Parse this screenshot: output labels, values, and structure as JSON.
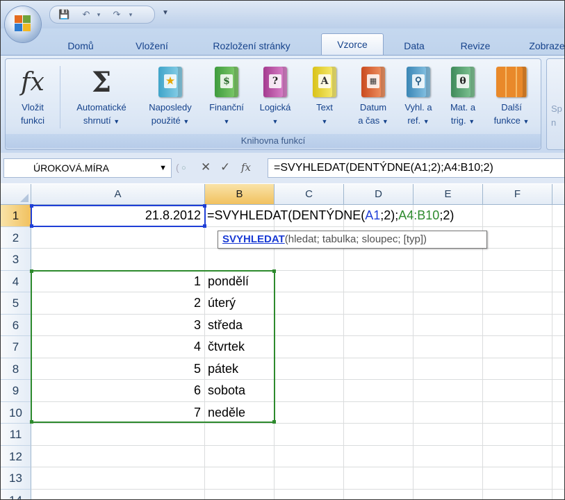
{
  "tabs": [
    "Domů",
    "Vložení",
    "Rozložení stránky",
    "Vzorce",
    "Data",
    "Revize",
    "Zobraze"
  ],
  "active_tab": "Vzorce",
  "ribbon": {
    "insert_function": {
      "line1": "Vložit",
      "line2": "funkci"
    },
    "autosum": {
      "line1": "Automatické",
      "line2": "shrnutí"
    },
    "recent": {
      "line1": "Naposledy",
      "line2": "použité"
    },
    "financial": {
      "line1": "Finanční"
    },
    "logical": {
      "line1": "Logická"
    },
    "text": {
      "line1": "Text"
    },
    "datetime": {
      "line1": "Datum",
      "line2": "a čas"
    },
    "lookup": {
      "line1": "Vyhl. a",
      "line2": "ref."
    },
    "math": {
      "line1": "Mat. a",
      "line2": "trig."
    },
    "more": {
      "line1": "Další",
      "line2": "funkce"
    },
    "group_label": "Knihovna funkcí",
    "next_group": {
      "line1": "Sp",
      "line2": "n"
    },
    "icons": [
      "fx-icon",
      "sigma-icon",
      "star-book-icon",
      "money-book-icon",
      "question-book-icon",
      "letter-book-icon",
      "calendar-book-icon",
      "magnifier-book-icon",
      "theta-book-icon",
      "books-icon"
    ]
  },
  "formula_bar": {
    "name_box": "ÚROKOVÁ.MÍRA",
    "formula": "=SVYHLEDAT(DENTÝDNE(A1;2);A4:B10;2)",
    "fx": "fx"
  },
  "columns": [
    "A",
    "B",
    "C",
    "D",
    "E",
    "F"
  ],
  "rows": [
    "1",
    "2",
    "3",
    "4",
    "5",
    "6",
    "7",
    "8",
    "9",
    "10",
    "11",
    "12",
    "13",
    "14"
  ],
  "cells": {
    "A1": "21.8.2012",
    "B1_parts": [
      "=SVYHLEDAT(DENTÝDNE(",
      "A1",
      ";2);",
      "A4:B10",
      ";2)"
    ],
    "A4": "1",
    "B4": "pondělí",
    "A5": "2",
    "B5": "úterý",
    "A6": "3",
    "B6": "středa",
    "A7": "4",
    "B7": "čtvrtek",
    "A8": "5",
    "B8": "pátek",
    "A9": "6",
    "B9": "sobota",
    "A10": "7",
    "B10": "neděle"
  },
  "tooltip": {
    "fn": "SVYHLEDAT",
    "args": "(hledat; tabulka; sloupec; [typ])"
  },
  "colors": {
    "ref_a1": "#1f3fd6",
    "ref_range": "#2d8a2d",
    "selected_header": "#f1c15f"
  }
}
